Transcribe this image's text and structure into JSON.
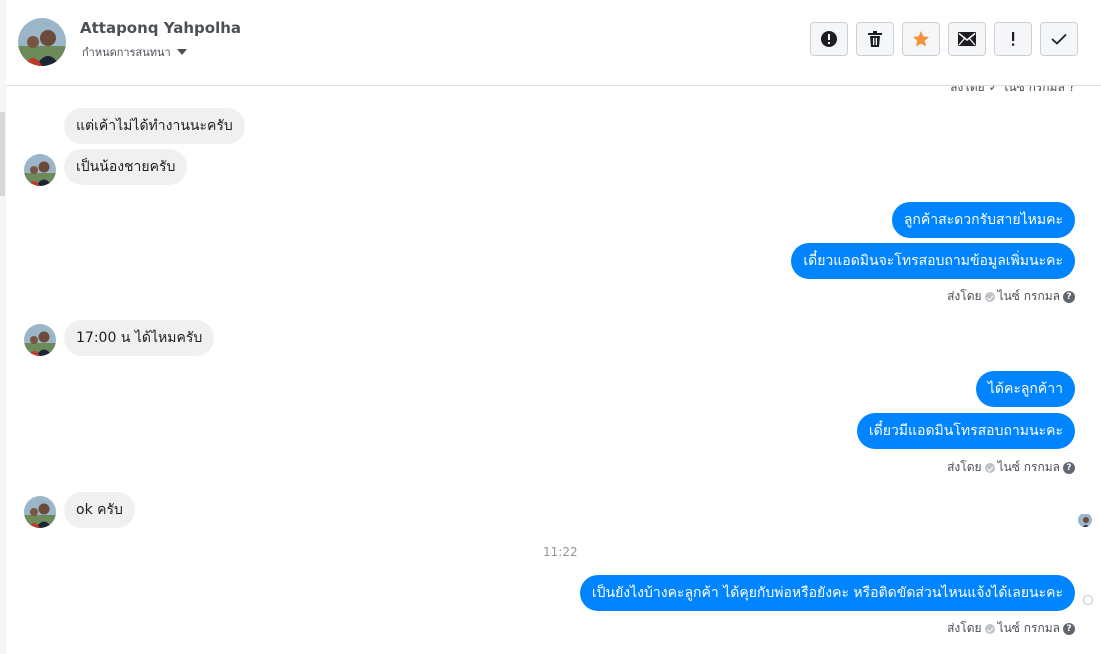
{
  "header": {
    "contact_name": "Attaponq Yahpolha",
    "conversation_settings_label": "กำหนดการสนทนา"
  },
  "toolbar": {
    "buttons": [
      "report-icon",
      "trash-icon",
      "star-icon",
      "envelope-icon",
      "exclamation-icon",
      "check-icon"
    ],
    "star_color": "#f7923b"
  },
  "thread": {
    "clipped_sender_text": "ส่งโดย ✓ ไนซ์ กรกมล ?",
    "messages": [
      {
        "direction": "in",
        "text": "แต่เค้าไม่ได้ทำงานนะครับ"
      },
      {
        "direction": "in",
        "text": "เป็นน้องชายครับ"
      },
      {
        "direction": "out",
        "text": "ลูกค้าสะดวกรับสายไหมคะ"
      },
      {
        "direction": "out",
        "text": "เดี๋ยวแอดมินจะโทรสอบถามข้อมูลเพิ่มนะคะ"
      },
      {
        "direction": "in",
        "text": "17:00 น ได้ไหมครับ"
      },
      {
        "direction": "out",
        "text": "ได้คะลูกค้าา"
      },
      {
        "direction": "out",
        "text": "เดี๋ยวมีแอดมินโทรสอบถามนะคะ"
      },
      {
        "direction": "in",
        "text": "ok ครับ"
      },
      {
        "direction": "out",
        "text": "เป็นยังไงบ้างคะลูกค้า ได้คุยกับพ่อหรือยังคะ หรือติดขัดส่วนไหนแจ้งได้เลยนะคะ"
      }
    ],
    "sent_by_prefix": "ส่งโดย",
    "sent_by_name": "ไนซ์ กรกมล",
    "timestamp": "11:22",
    "colors": {
      "outgoing": "#0084ff",
      "incoming": "#f1f0f0"
    }
  }
}
